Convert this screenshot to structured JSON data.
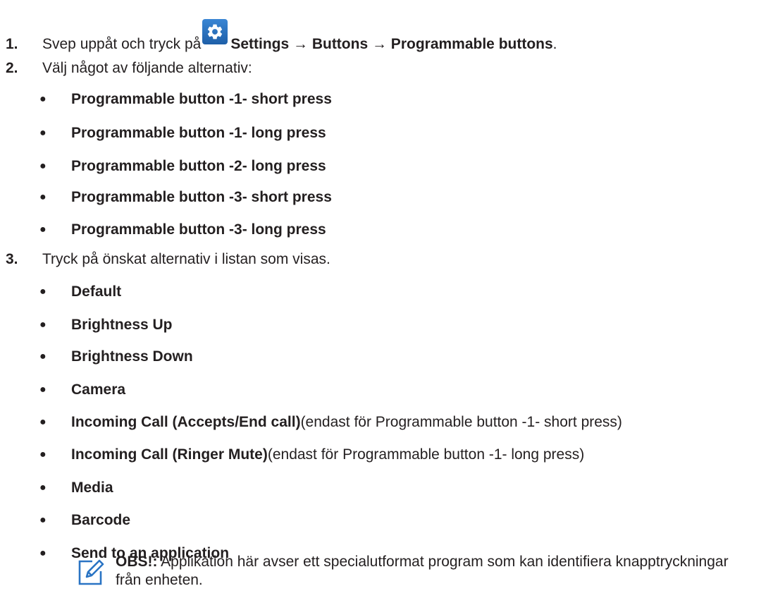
{
  "steps": [
    {
      "num": "1.",
      "text_before": "Svep uppåt och tryck på",
      "path": "Settings → Buttons → Programmable buttons",
      "text_after": "."
    },
    {
      "num": "2.",
      "text": "Välj något av följande alternativ:"
    },
    {
      "num": "3.",
      "text": "Tryck på önskat alternativ i listan som visas."
    }
  ],
  "step1_icon": "settings-gear-icon",
  "options_button": [
    "Programmable button -1- short press",
    "Programmable button -1- long press",
    "Programmable button -2- long press",
    "Programmable button -3- short press",
    "Programmable button -3- long press"
  ],
  "options_function": [
    {
      "bold": "Default",
      "normal": ""
    },
    {
      "bold": "Brightness Up",
      "normal": ""
    },
    {
      "bold": "Brightness Down",
      "normal": ""
    },
    {
      "bold": "Camera",
      "normal": ""
    },
    {
      "bold": "Incoming Call (Accepts/End call)",
      "normal": "(endast för Programmable button -1- short press)"
    },
    {
      "bold": "Incoming Call (Ringer Mute)",
      "normal": "(endast för Programmable button -1- long press)"
    },
    {
      "bold": "Media",
      "normal": ""
    },
    {
      "bold": "Barcode",
      "normal": ""
    },
    {
      "bold": "Send to an application",
      "normal": ""
    }
  ],
  "note": {
    "label": "OBS!:",
    "text": " Applikation här avser ett specialutformat program som kan identifiera knapptryckningar från enheten.",
    "icon": "note-pencil-icon"
  },
  "colors": {
    "text": "#231f20",
    "icon_blue": "#2a74c4"
  }
}
